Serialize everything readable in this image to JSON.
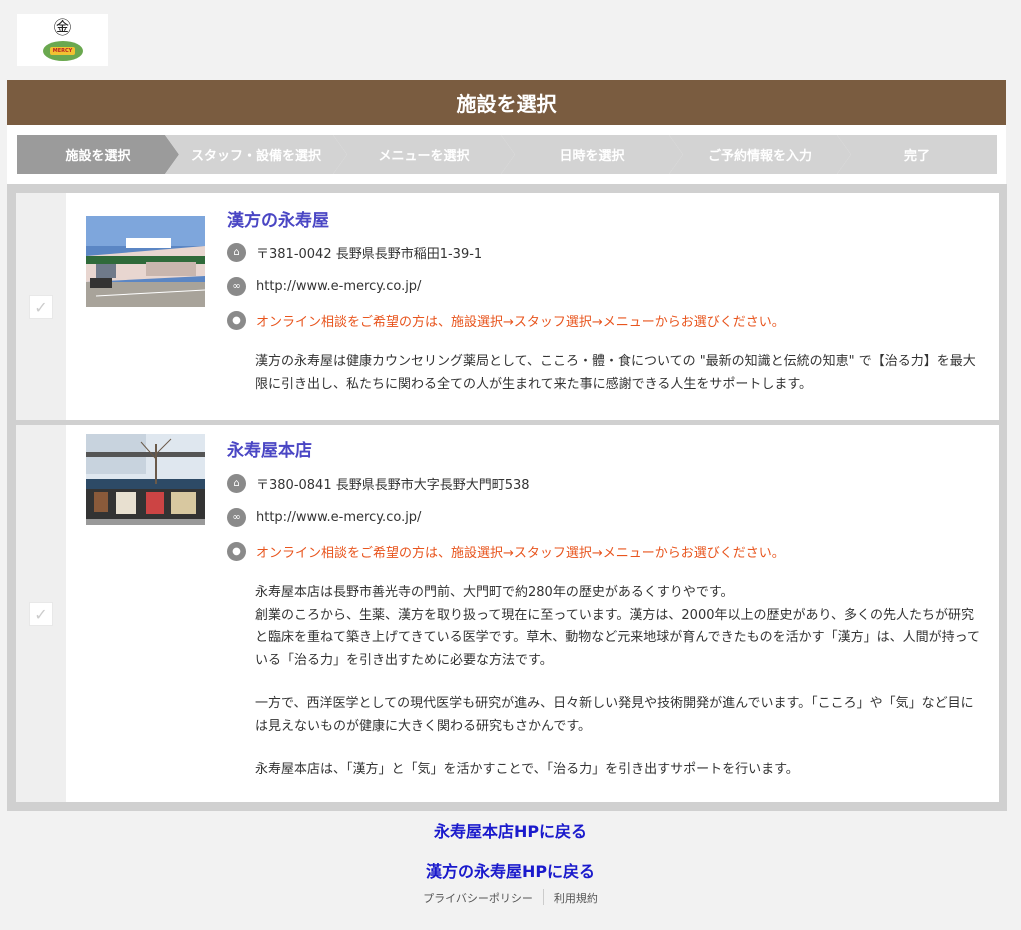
{
  "logo": {
    "mark": "㊎",
    "badge": "MERCY"
  },
  "header": {
    "title": "施設を選択"
  },
  "steps": [
    {
      "label": "施設を選択"
    },
    {
      "label": "スタッフ・設備を選択"
    },
    {
      "label": "メニューを選択"
    },
    {
      "label": "日時を選択"
    },
    {
      "label": "ご予約情報を入力"
    },
    {
      "label": "完了"
    }
  ],
  "facilities": [
    {
      "name": "漢方の永寿屋",
      "address": "〒381-0042  長野県長野市稲田1-39-1",
      "url": "http://www.e-mercy.co.jp/",
      "notice": "オンライン相談をご希望の方は、施設選択→スタッフ選択→メニューからお選びください。",
      "desc": [
        "漢方の永寿屋は健康カウンセリング薬局として、こころ・體・食についての \"最新の知識と伝統の知恵\" で【治る力】を最大限に引き出し、私たちに関わる全ての人が生まれて来た事に感謝できる人生をサポートします。"
      ]
    },
    {
      "name": "永寿屋本店",
      "address": "〒380-0841  長野県長野市大字長野大門町538",
      "url": "http://www.e-mercy.co.jp/",
      "notice": "オンライン相談をご希望の方は、施設選択→スタッフ選択→メニューからお選びください。",
      "desc": [
        "永寿屋本店は長野市善光寺の門前、大門町で約280年の歴史があるくすりやです。",
        "創業のころから、生薬、漢方を取り扱って現在に至っています。漢方は、2000年以上の歴史があり、多くの先人たちが研究と臨床を重ねて築き上げてきている医学です。草木、動物など元来地球が育んできたものを活かす「漢方」は、人間が持っている「治る力」を引き出すために必要な方法です。",
        "一方で、西洋医学としての現代医学も研究が進み、日々新しい発見や技術開発が進んでいます。「こころ」や「気」など目には見えないものが健康に大きく関わる研究もさかんです。",
        "永寿屋本店は、「漢方」と「気」を活かすことで、「治る力」を引き出すサポートを行います。"
      ]
    }
  ],
  "links": {
    "honten": "永寿屋本店HPに戻る",
    "kampo": "漢方の永寿屋HPに戻る"
  },
  "footer": {
    "privacy": "プライバシーポリシー",
    "terms": "利用規約"
  },
  "colors": {
    "header_bg": "#7a5c40",
    "step_active": "#9b9b9b",
    "step_inactive": "#d3d3d3",
    "title_link": "#4a46c4",
    "notice": "#e8551e",
    "bottom_link": "#1a1acc"
  },
  "icons": {
    "address": "home-icon",
    "url": "link-icon",
    "notice": "chat-icon",
    "check": "check-icon"
  }
}
